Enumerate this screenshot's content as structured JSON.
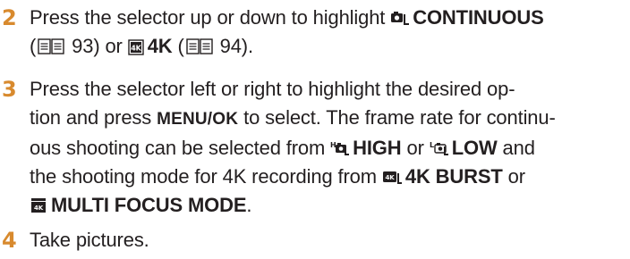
{
  "steps": [
    {
      "number": "2",
      "text_1": "Press the selector up or down to highlight ",
      "continuous_label": "CONTINUOUS",
      "continuous_ref_open": " (",
      "continuous_ref_page": " 93) or ",
      "fourk_label": "4K",
      "fourk_ref_open": " (",
      "fourk_ref_page": " 94).",
      "icon_continuous": "continuous-shooting-icon",
      "icon_4k": "4k-icon",
      "icon_book": "book-reference-icon"
    },
    {
      "number": "3",
      "line1": "Press the selector left or right to highlight the desired op-",
      "line2_a": "tion and press ",
      "menu_ok": "MENU/OK",
      "line2_b": " to select. The frame rate for continu-",
      "line3_a": "ous shooting can be selected from ",
      "high_label": "HIGH",
      "line3_b": " or ",
      "low_label": "LOW",
      "line3_c": " and",
      "line4_a": "the shooting mode for 4K recording from ",
      "burst_label": "4K BURST",
      "line4_b": " or",
      "multi_label": "MULTI FOCUS MODE",
      "line5_end": ".",
      "icon_high": "continuous-high-icon",
      "icon_low": "continuous-low-icon",
      "icon_burst": "4k-burst-icon",
      "icon_multi": "multi-focus-icon"
    },
    {
      "number": "4",
      "text": "Take pictures."
    }
  ]
}
